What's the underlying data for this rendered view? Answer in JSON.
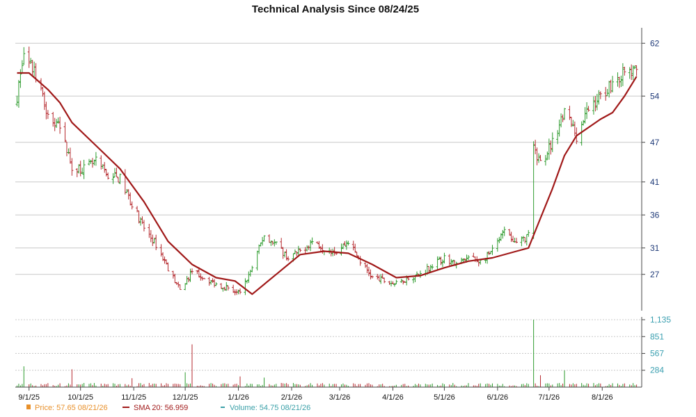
{
  "chart_data": {
    "type": "line",
    "title": "Technical Analysis Since 08/24/25",
    "price_axis": {
      "ticks": [
        27,
        31,
        36,
        41,
        47,
        54,
        62
      ],
      "tick_labels": [
        "27",
        "31",
        "36",
        "41",
        "47",
        "54",
        "62"
      ],
      "ylim": [
        21.5,
        63.5
      ]
    },
    "volume_axis": {
      "ticks": [
        284,
        567,
        851,
        1135
      ],
      "tick_labels": [
        "284",
        "567",
        "851",
        "1,135"
      ],
      "ylim": [
        0,
        1135
      ]
    },
    "x_tick_labels": [
      "9/1/25",
      "10/1/25",
      "11/1/25",
      "12/1/25",
      "1/1/26",
      "2/1/26",
      "3/1/26",
      "4/1/26",
      "5/1/26",
      "6/1/26",
      "7/1/26",
      "8/1/26"
    ],
    "grid": true,
    "colors": {
      "up": "#2b9a2b",
      "down": "#b5282d",
      "sma": "#a01818",
      "volume": "#3aa0a8",
      "price_legend": "#e8902a",
      "grid": "#c8c8c8",
      "axis_label": "#1f3a78"
    },
    "price_keypoints": [
      [
        "2025-08-25",
        54.0
      ],
      [
        "2025-08-29",
        60.5
      ],
      [
        "2025-09-05",
        57.0
      ],
      [
        "2025-09-12",
        51.0
      ],
      [
        "2025-09-19",
        49.0
      ],
      [
        "2025-09-26",
        43.5
      ],
      [
        "2025-10-03",
        43.0
      ],
      [
        "2025-10-10",
        44.0
      ],
      [
        "2025-10-17",
        42.0
      ],
      [
        "2025-10-24",
        41.5
      ],
      [
        "2025-10-31",
        37.5
      ],
      [
        "2025-11-07",
        34.0
      ],
      [
        "2025-11-14",
        31.5
      ],
      [
        "2025-11-21",
        28.0
      ],
      [
        "2025-11-28",
        24.5
      ],
      [
        "2025-12-05",
        27.5
      ],
      [
        "2025-12-12",
        26.5
      ],
      [
        "2025-12-19",
        25.5
      ],
      [
        "2025-12-26",
        25.0
      ],
      [
        "2026-01-02",
        24.0
      ],
      [
        "2026-01-09",
        28.0
      ],
      [
        "2026-01-16",
        33.0
      ],
      [
        "2026-01-23",
        31.5
      ],
      [
        "2026-01-30",
        29.5
      ],
      [
        "2026-02-06",
        30.5
      ],
      [
        "2026-02-13",
        32.0
      ],
      [
        "2026-02-20",
        31.0
      ],
      [
        "2026-02-27",
        30.5
      ],
      [
        "2026-03-06",
        32.0
      ],
      [
        "2026-03-13",
        29.0
      ],
      [
        "2026-03-20",
        26.5
      ],
      [
        "2026-03-27",
        26.0
      ],
      [
        "2026-04-03",
        25.5
      ],
      [
        "2026-04-10",
        26.5
      ],
      [
        "2026-04-17",
        27.0
      ],
      [
        "2026-04-24",
        28.5
      ],
      [
        "2026-05-01",
        29.5
      ],
      [
        "2026-05-08",
        28.5
      ],
      [
        "2026-05-15",
        29.5
      ],
      [
        "2026-05-22",
        29.0
      ],
      [
        "2026-05-29",
        30.5
      ],
      [
        "2026-06-05",
        33.5
      ],
      [
        "2026-06-12",
        31.5
      ],
      [
        "2026-06-19",
        33.0
      ],
      [
        "2026-06-22",
        46.0
      ],
      [
        "2026-06-26",
        44.0
      ],
      [
        "2026-07-03",
        47.0
      ],
      [
        "2026-07-10",
        52.0
      ],
      [
        "2026-07-17",
        48.0
      ],
      [
        "2026-07-24",
        52.0
      ],
      [
        "2026-07-31",
        54.0
      ],
      [
        "2026-08-07",
        56.0
      ],
      [
        "2026-08-14",
        57.5
      ],
      [
        "2026-08-21",
        57.65
      ]
    ],
    "sma_keypoints": [
      [
        "2025-08-25",
        57.5
      ],
      [
        "2025-09-01",
        57.5
      ],
      [
        "2025-09-12",
        55.0
      ],
      [
        "2025-09-19",
        53.0
      ],
      [
        "2025-09-26",
        50.0
      ],
      [
        "2025-10-10",
        46.5
      ],
      [
        "2025-10-24",
        43.0
      ],
      [
        "2025-11-07",
        38.0
      ],
      [
        "2025-11-21",
        32.0
      ],
      [
        "2025-12-05",
        28.5
      ],
      [
        "2025-12-19",
        26.5
      ],
      [
        "2025-12-30",
        26.0
      ],
      [
        "2026-01-09",
        24.0
      ],
      [
        "2026-01-23",
        27.0
      ],
      [
        "2026-02-06",
        30.0
      ],
      [
        "2026-02-20",
        30.5
      ],
      [
        "2026-03-06",
        30.2
      ],
      [
        "2026-03-20",
        28.5
      ],
      [
        "2026-04-03",
        26.5
      ],
      [
        "2026-04-17",
        26.8
      ],
      [
        "2026-05-01",
        28.0
      ],
      [
        "2026-05-15",
        29.0
      ],
      [
        "2026-05-29",
        29.5
      ],
      [
        "2026-06-12",
        30.5
      ],
      [
        "2026-06-19",
        31.0
      ],
      [
        "2026-06-26",
        35.5
      ],
      [
        "2026-07-03",
        40.0
      ],
      [
        "2026-07-10",
        45.0
      ],
      [
        "2026-07-17",
        48.0
      ],
      [
        "2026-07-31",
        50.5
      ],
      [
        "2026-08-07",
        51.5
      ],
      [
        "2026-08-14",
        54.0
      ],
      [
        "2026-08-21",
        56.959
      ]
    ],
    "volume_spikes": [
      [
        "2025-08-29",
        350
      ],
      [
        "2025-09-26",
        300
      ],
      [
        "2025-10-31",
        150
      ],
      [
        "2025-12-01",
        250
      ],
      [
        "2025-12-05",
        720
      ],
      [
        "2026-01-02",
        180
      ],
      [
        "2026-01-16",
        160
      ],
      [
        "2026-03-01",
        230
      ],
      [
        "2026-06-22",
        1135
      ],
      [
        "2026-06-26",
        200
      ],
      [
        "2026-07-10",
        280
      ]
    ],
    "legend": [
      {
        "label": "Price: 57.65  08/21/26",
        "color": "#e8902a",
        "marker": "square"
      },
      {
        "label": "SMA 20: 56.959",
        "color": "#a01818",
        "marker": "line"
      },
      {
        "label": "Volume: 54.75  08/21/26",
        "color": "#3aa0a8",
        "marker": "dash"
      }
    ],
    "legend_position": "bottom-left"
  }
}
